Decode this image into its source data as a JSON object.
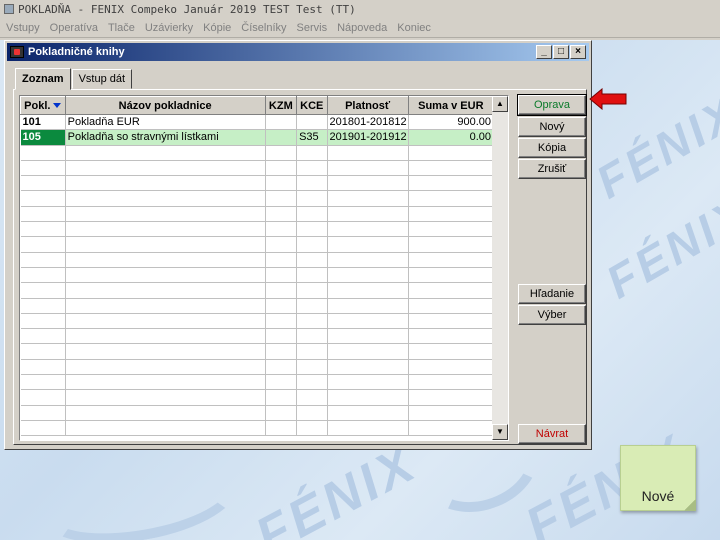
{
  "app": {
    "title": "POKLADŇA - FENIX Compeko  Január 2019  TEST Test  (TT)"
  },
  "menu": [
    "Vstupy",
    "Operatíva",
    "Tlače",
    "Uzávierky",
    "Kópie",
    "Číselníky",
    "Servis",
    "Nápoveda",
    "Koniec"
  ],
  "window": {
    "title": "Pokladničné knihy",
    "controls": [
      "_",
      "□",
      "×"
    ]
  },
  "tabs": [
    {
      "label": "Zoznam",
      "active": true
    },
    {
      "label": "Vstup dát",
      "active": false
    }
  ],
  "table": {
    "columns": [
      "Pokl.",
      "Názov pokladnice",
      "KZM",
      "KCE",
      "Platnosť",
      "Suma v EUR"
    ],
    "rows": [
      {
        "pokl": "101",
        "nazov": "Pokladňa EUR",
        "kzm": "",
        "kce": "",
        "platnost": "201801-201812",
        "suma": "900.00",
        "selected": false
      },
      {
        "pokl": "105",
        "nazov": "Pokladňa so stravnými lístkami",
        "kzm": "",
        "kce": "S35",
        "platnost": "201901-201912",
        "suma": "0.00",
        "selected": true
      }
    ],
    "empty_rows": 19
  },
  "buttons": {
    "oprava": "Oprava",
    "novy": "Nový",
    "kopia": "Kópia",
    "zrusit": "Zrušiť",
    "hladanie": "Hľadanie",
    "vyber": "Výber",
    "navrat": "Návrat"
  },
  "colors": {
    "selected_row": "#c6efc6",
    "selected_key": "#0b8a3e",
    "titlebar": "#0a246a",
    "arrow": "#e01010"
  },
  "note": {
    "text": "Nové"
  },
  "watermark": "FÉNIX"
}
